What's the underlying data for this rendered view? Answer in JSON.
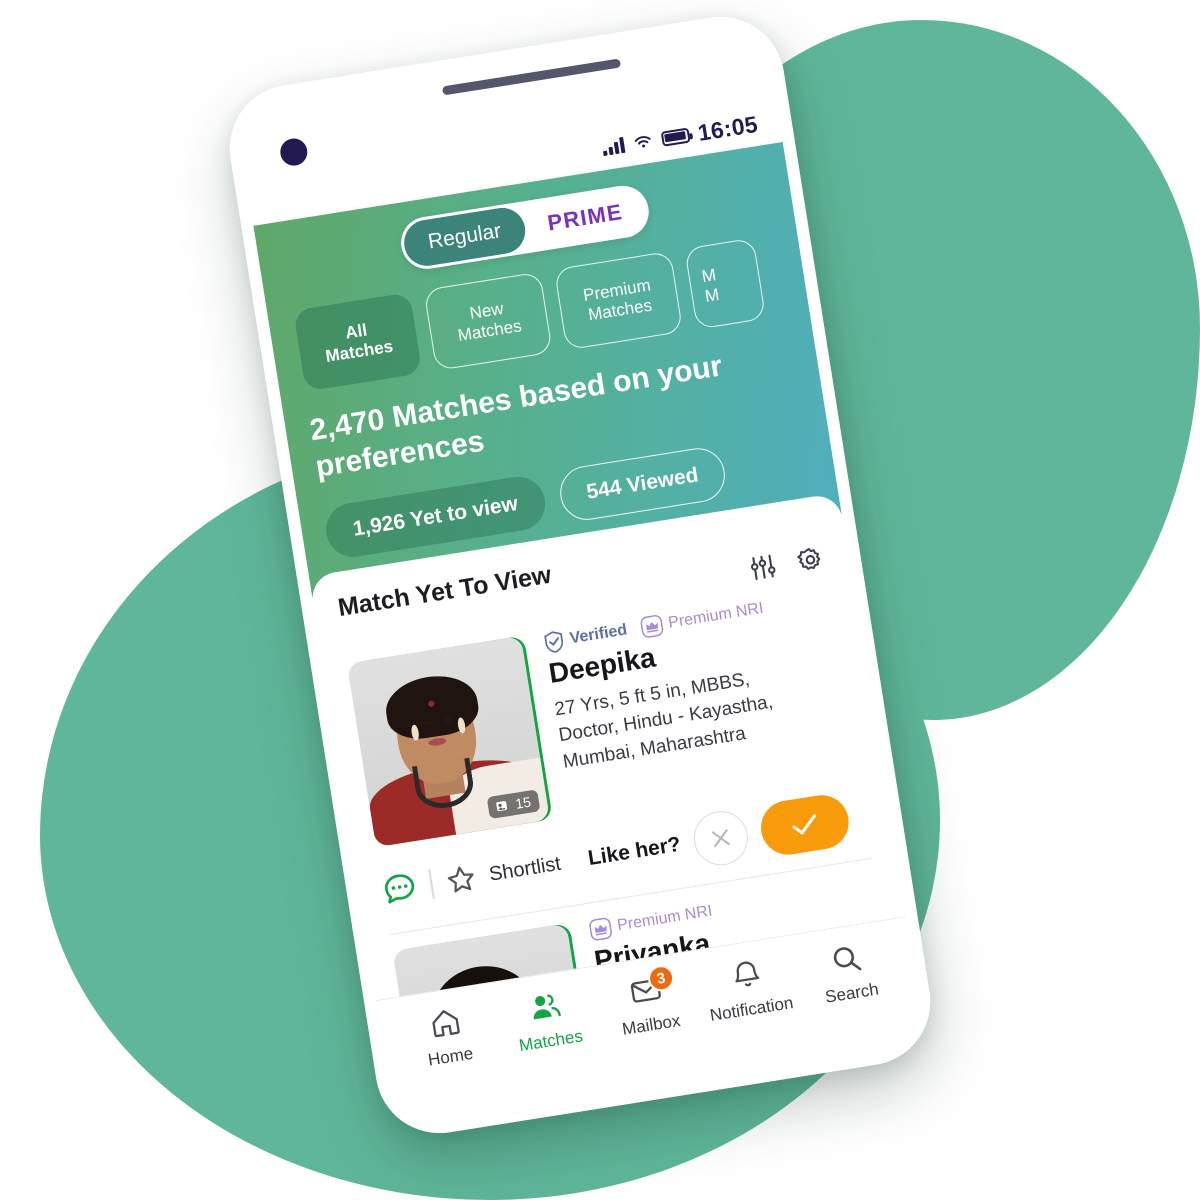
{
  "background": {
    "blob_color": "#5FB69A",
    "page_color": "#FFFFFF"
  },
  "phone": {
    "frame_color": "#FFFFFF",
    "rotation_degrees": -9,
    "speaker": "speaker-grille",
    "camera": "front-camera"
  },
  "status_bar": {
    "time": "16:05",
    "signal_icon": "cellular-signal-icon",
    "wifi_icon": "wifi-icon",
    "battery_icon": "battery-full-icon",
    "icon_color": "#241A52"
  },
  "header": {
    "gradient_from": "#5FA869",
    "gradient_mid": "#57B08C",
    "gradient_to": "#4FAFBC",
    "segmented_toggle": {
      "options": [
        {
          "label": "Regular",
          "active": true
        },
        {
          "label": "PRIME",
          "active": false,
          "color": "#7B2FBF"
        }
      ]
    },
    "filter_chips": [
      {
        "label": "All\nMatches",
        "active": true
      },
      {
        "label": "New\nMatches",
        "active": false
      },
      {
        "label": "Premium\nMatches",
        "active": false
      },
      {
        "label": "M\nM",
        "active": false,
        "truncated": true
      }
    ],
    "headline": "2,470 Matches based on your preferences",
    "stats": [
      {
        "label": "1,926 Yet to view",
        "filled": true
      },
      {
        "label": "544 Viewed",
        "filled": false
      }
    ]
  },
  "content": {
    "section_title": "Match Yet To View",
    "header_icons": [
      {
        "name": "filter-sliders-icon"
      },
      {
        "name": "settings-gear-icon"
      }
    ],
    "profiles": [
      {
        "name": "Deepika",
        "badges": [
          {
            "label": "Verified",
            "icon": "verified-shield-icon",
            "color": "#5B6FA8"
          },
          {
            "label": "Premium NRI",
            "icon": "crown-icon",
            "color": "#A98AD4"
          }
        ],
        "details": "27 Yrs, 5 ft 5 in, MBBS, Doctor, Hindu - Kayastha, Mumbai, Maharashtra",
        "photo_count": "15",
        "photo_count_icon": "photo-stack-icon"
      },
      {
        "name": "Priyanka",
        "badges": [
          {
            "label": "Premium NRI",
            "icon": "crown-icon",
            "color": "#A98AD4"
          }
        ]
      }
    ],
    "actions": {
      "chat_icon": "chat-bubble-icon",
      "shortlist_icon": "star-outline-icon",
      "shortlist_label": "Shortlist",
      "like_prompt": "Like her?",
      "decline_icon": "close-x-icon",
      "accept_icon": "check-icon",
      "accept_color": "#F79B0B"
    }
  },
  "bottom_nav": {
    "active_color": "#14A444",
    "items": [
      {
        "label": "Home",
        "icon": "home-icon",
        "active": false,
        "badge": ""
      },
      {
        "label": "Matches",
        "icon": "people-icon",
        "active": true,
        "badge": ""
      },
      {
        "label": "Mailbox",
        "icon": "envelope-icon",
        "active": false,
        "badge": "3"
      },
      {
        "label": "Notification",
        "icon": "bell-icon",
        "active": false,
        "badge": ""
      },
      {
        "label": "Search",
        "icon": "magnifier-icon",
        "active": false,
        "badge": ""
      }
    ]
  }
}
